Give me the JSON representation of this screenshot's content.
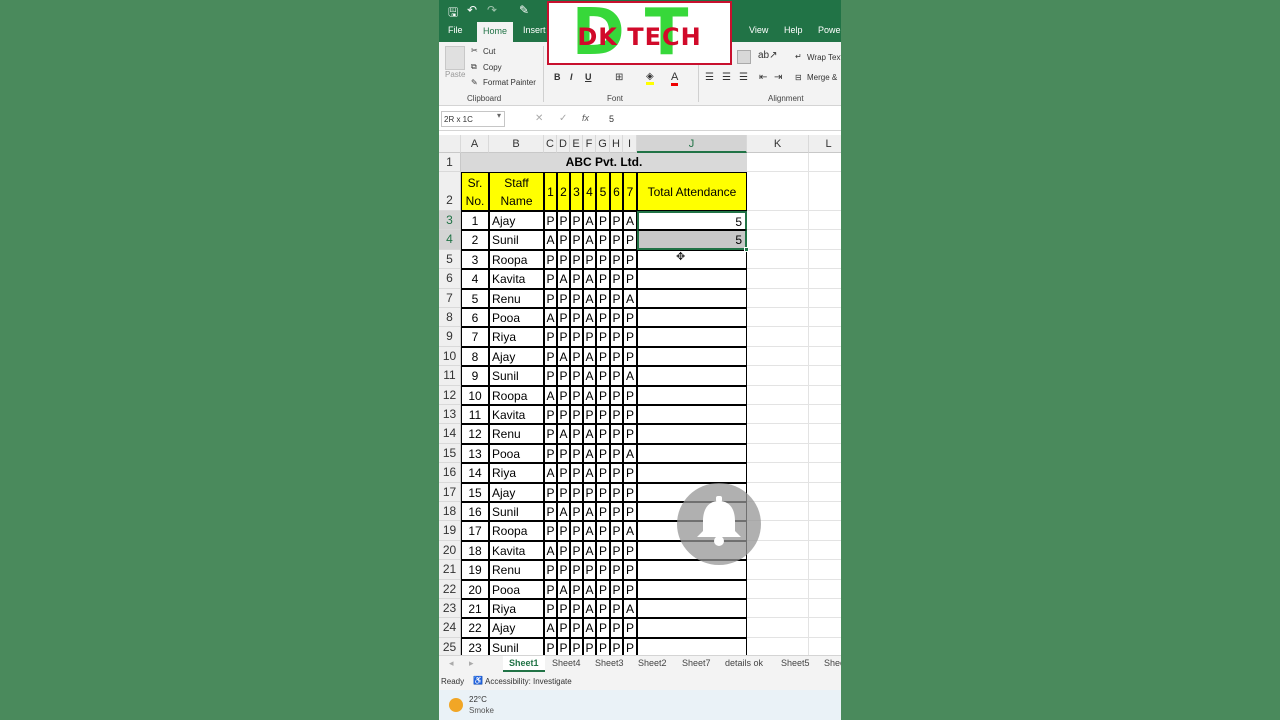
{
  "logo": {
    "letters": "DT",
    "text": "DK TECH"
  },
  "ribbon": {
    "tabs": [
      "File",
      "Home",
      "Insert",
      "View",
      "Help",
      "Power"
    ],
    "clipboard": {
      "paste": "Paste",
      "cut": "Cut",
      "copy": "Copy",
      "format_painter": "Format Painter",
      "group": "Clipboard"
    },
    "font": {
      "bold": "B",
      "italic": "I",
      "underline": "U",
      "group": "Font"
    },
    "alignment": {
      "wrap": "Wrap Text",
      "merge": "Merge &",
      "group": "Alignment"
    }
  },
  "formula_bar": {
    "name_box": "2R x 1C",
    "fx": "fx",
    "value": "5"
  },
  "sheet": {
    "columns": [
      "A",
      "B",
      "C",
      "D",
      "E",
      "F",
      "G",
      "H",
      "I",
      "J",
      "K",
      "L"
    ],
    "title": "ABC Pvt. Ltd.",
    "headers": {
      "sr1": "Sr.",
      "sr2": "No.",
      "name1": "Staff",
      "name2": "Name",
      "days": [
        "1",
        "2",
        "3",
        "4",
        "5",
        "6",
        "7"
      ],
      "total": "Total Attendance"
    },
    "rows": [
      {
        "sr": "1",
        "name": "Ajay",
        "att": [
          "P",
          "P",
          "P",
          "A",
          "P",
          "P",
          "A"
        ],
        "total": "5"
      },
      {
        "sr": "2",
        "name": "Sunil",
        "att": [
          "A",
          "P",
          "P",
          "A",
          "P",
          "P",
          "P"
        ],
        "total": "5"
      },
      {
        "sr": "3",
        "name": "Roopa",
        "att": [
          "P",
          "P",
          "P",
          "P",
          "P",
          "P",
          "P"
        ],
        "total": ""
      },
      {
        "sr": "4",
        "name": "Kavita",
        "att": [
          "P",
          "A",
          "P",
          "A",
          "P",
          "P",
          "P"
        ],
        "total": ""
      },
      {
        "sr": "5",
        "name": "Renu",
        "att": [
          "P",
          "P",
          "P",
          "A",
          "P",
          "P",
          "A"
        ],
        "total": ""
      },
      {
        "sr": "6",
        "name": "Pooa",
        "att": [
          "A",
          "P",
          "P",
          "A",
          "P",
          "P",
          "P"
        ],
        "total": ""
      },
      {
        "sr": "7",
        "name": "Riya",
        "att": [
          "P",
          "P",
          "P",
          "P",
          "P",
          "P",
          "P"
        ],
        "total": ""
      },
      {
        "sr": "8",
        "name": "Ajay",
        "att": [
          "P",
          "A",
          "P",
          "A",
          "P",
          "P",
          "P"
        ],
        "total": ""
      },
      {
        "sr": "9",
        "name": "Sunil",
        "att": [
          "P",
          "P",
          "P",
          "A",
          "P",
          "P",
          "A"
        ],
        "total": ""
      },
      {
        "sr": "10",
        "name": "Roopa",
        "att": [
          "A",
          "P",
          "P",
          "A",
          "P",
          "P",
          "P"
        ],
        "total": ""
      },
      {
        "sr": "11",
        "name": "Kavita",
        "att": [
          "P",
          "P",
          "P",
          "P",
          "P",
          "P",
          "P"
        ],
        "total": ""
      },
      {
        "sr": "12",
        "name": "Renu",
        "att": [
          "P",
          "A",
          "P",
          "A",
          "P",
          "P",
          "P"
        ],
        "total": ""
      },
      {
        "sr": "13",
        "name": "Pooa",
        "att": [
          "P",
          "P",
          "P",
          "A",
          "P",
          "P",
          "A"
        ],
        "total": ""
      },
      {
        "sr": "14",
        "name": "Riya",
        "att": [
          "A",
          "P",
          "P",
          "A",
          "P",
          "P",
          "P"
        ],
        "total": ""
      },
      {
        "sr": "15",
        "name": "Ajay",
        "att": [
          "P",
          "P",
          "P",
          "P",
          "P",
          "P",
          "P"
        ],
        "total": ""
      },
      {
        "sr": "16",
        "name": "Sunil",
        "att": [
          "P",
          "A",
          "P",
          "A",
          "P",
          "P",
          "P"
        ],
        "total": ""
      },
      {
        "sr": "17",
        "name": "Roopa",
        "att": [
          "P",
          "P",
          "P",
          "A",
          "P",
          "P",
          "A"
        ],
        "total": ""
      },
      {
        "sr": "18",
        "name": "Kavita",
        "att": [
          "A",
          "P",
          "P",
          "A",
          "P",
          "P",
          "P"
        ],
        "total": ""
      },
      {
        "sr": "19",
        "name": "Renu",
        "att": [
          "P",
          "P",
          "P",
          "P",
          "P",
          "P",
          "P"
        ],
        "total": ""
      },
      {
        "sr": "20",
        "name": "Pooa",
        "att": [
          "P",
          "A",
          "P",
          "A",
          "P",
          "P",
          "P"
        ],
        "total": ""
      },
      {
        "sr": "21",
        "name": "Riya",
        "att": [
          "P",
          "P",
          "P",
          "A",
          "P",
          "P",
          "A"
        ],
        "total": ""
      },
      {
        "sr": "22",
        "name": "Ajay",
        "att": [
          "A",
          "P",
          "P",
          "A",
          "P",
          "P",
          "P"
        ],
        "total": ""
      },
      {
        "sr": "23",
        "name": "Sunil",
        "att": [
          "P",
          "P",
          "P",
          "P",
          "P",
          "P",
          "P"
        ],
        "total": ""
      }
    ]
  },
  "sheet_tabs": [
    "Sheet1",
    "Sheet4",
    "Sheet3",
    "Sheet2",
    "Sheet7",
    "details ok",
    "Sheet5",
    "Shee"
  ],
  "status": {
    "ready": "Ready",
    "accessibility": "Accessibility: Investigate"
  },
  "weather": {
    "temp": "22°C",
    "desc": "Smoke"
  }
}
